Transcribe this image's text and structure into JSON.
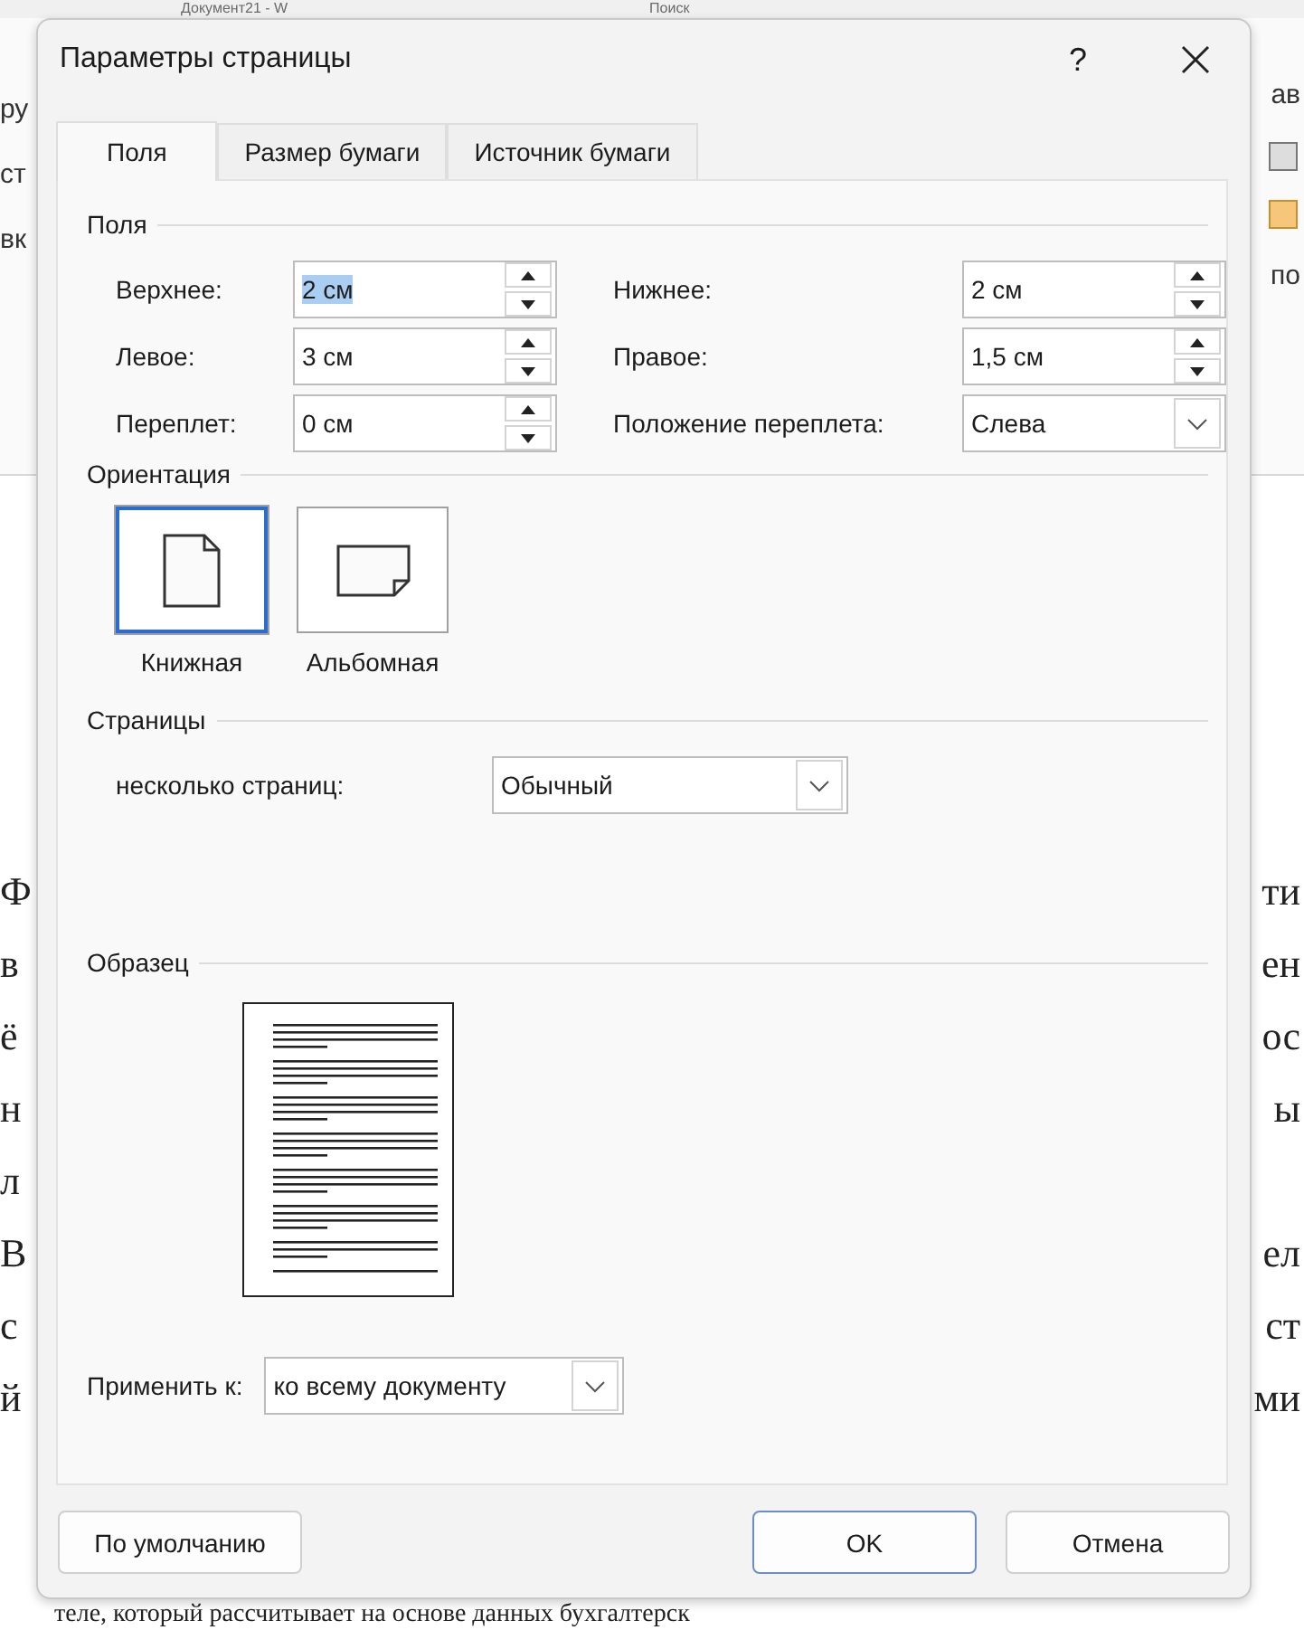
{
  "background": {
    "title": "Документ21  -  W",
    "search": "Поиск",
    "ribbon_left": [
      "ру",
      "ст",
      "вк"
    ],
    "ribbon_right": [
      "ав",
      "по"
    ],
    "document_lines": [
      {
        "left": "Ф",
        "right": "ти"
      },
      {
        "left": "в",
        "right": "ен"
      },
      {
        "left": "ё",
        "right": "ос"
      },
      {
        "left": "н",
        "right": "ы"
      },
      {
        "left": "л"
      },
      {
        "left": "В",
        "right": "ел"
      },
      {
        "left": "с",
        "right": "ст"
      },
      {
        "left": "й",
        "right": "ми"
      }
    ],
    "last_line": "теле, который рассчитывает на основе данных бухгалтерск"
  },
  "dialog": {
    "title": "Параметры страницы",
    "help": "?",
    "tabs": [
      {
        "label": "Поля",
        "selected": true
      },
      {
        "label": "Размер бумаги",
        "selected": false
      },
      {
        "label": "Источник бумаги",
        "selected": false
      }
    ],
    "margins": {
      "heading": "Поля",
      "fields": [
        {
          "kind": "spin",
          "label": "Верхнее:",
          "value": "2 см",
          "selected": true
        },
        {
          "kind": "spin",
          "label": "Нижнее:",
          "value": "2 см",
          "selected": false
        },
        {
          "kind": "spin",
          "label": "Левое:",
          "value": "3 см",
          "selected": false
        },
        {
          "kind": "spin",
          "label": "Правое:",
          "value": "1,5 см",
          "selected": false
        },
        {
          "kind": "spin",
          "label": "Переплет:",
          "value": "0 см",
          "selected": false
        },
        {
          "kind": "combo",
          "label": "Положение переплета:",
          "value": "Слева",
          "selected": false
        }
      ]
    },
    "orientation": {
      "heading": "Ориентация",
      "options": [
        {
          "kind": "portrait",
          "label": "Книжная",
          "selected": true
        },
        {
          "kind": "landscape",
          "label": "Альбомная",
          "selected": false
        }
      ]
    },
    "pages": {
      "heading": "Страницы",
      "label": "несколько страниц:",
      "value": "Обычный"
    },
    "preview": {
      "heading": "Образец"
    },
    "apply_to": {
      "label": "Применить к:",
      "value": "ко всему документу"
    },
    "buttons": [
      {
        "kind": "default",
        "label": "По умолчанию"
      },
      {
        "kind": "primary",
        "label": "OK"
      },
      {
        "kind": "cancel",
        "label": "Отмена"
      }
    ]
  }
}
